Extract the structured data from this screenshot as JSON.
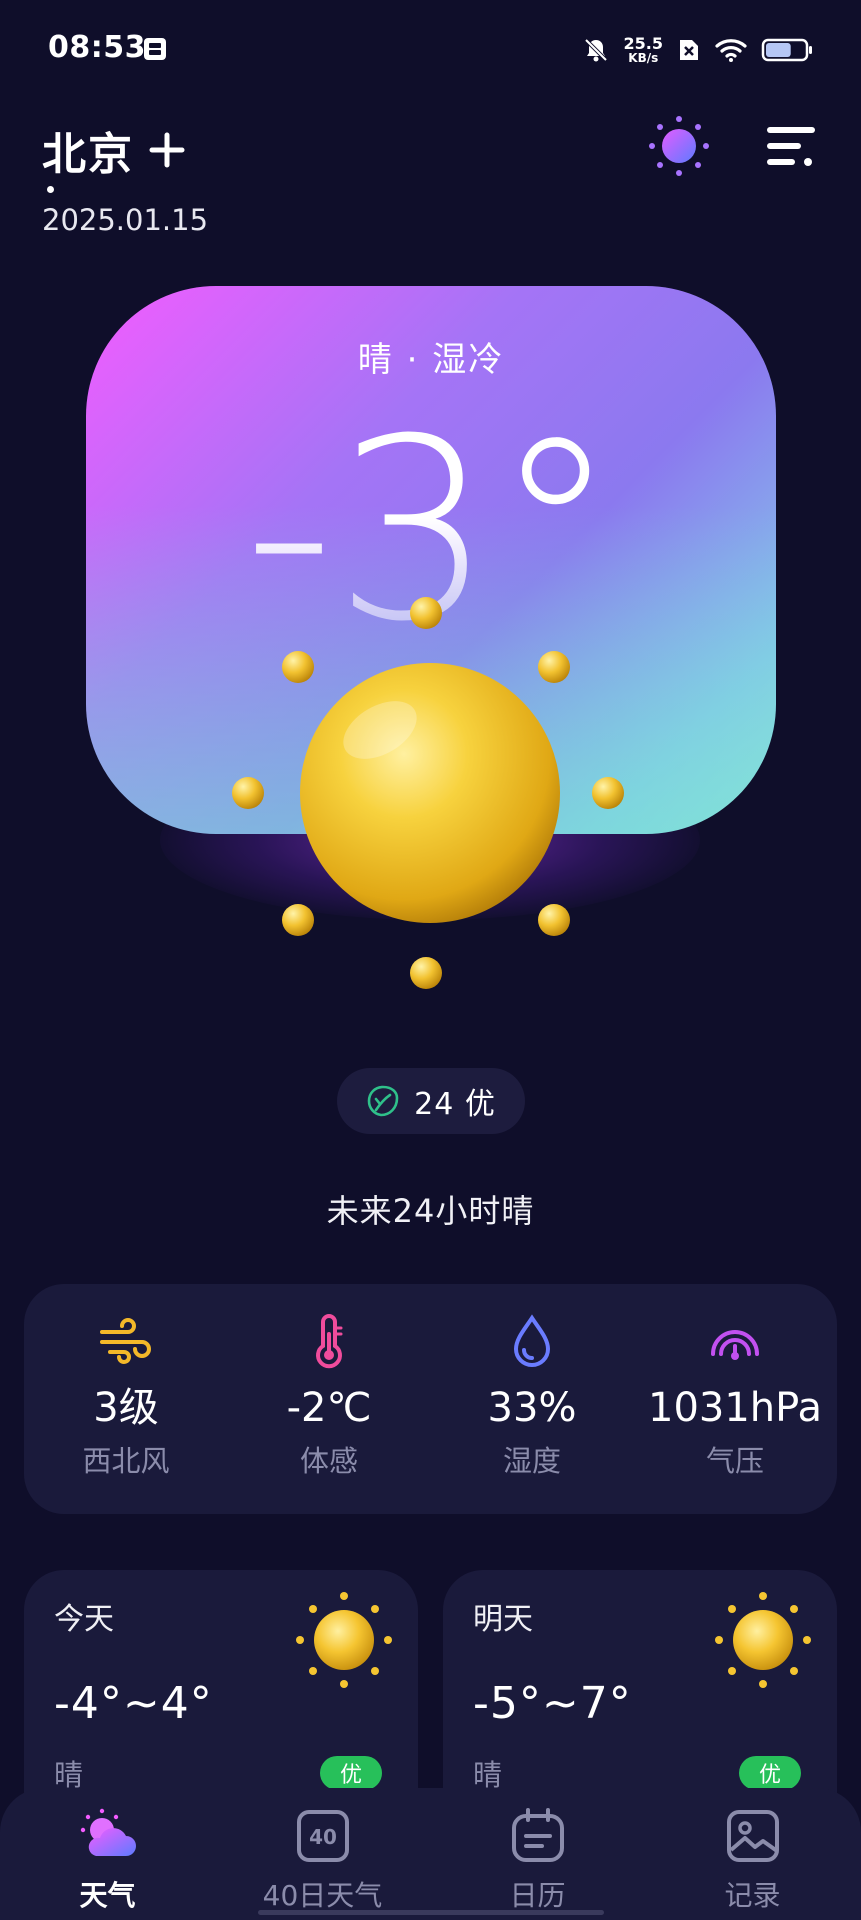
{
  "status_bar": {
    "time": "08:53",
    "net_speed_value": "25.5",
    "net_speed_unit": "KB/s",
    "battery_level": 0.65
  },
  "header": {
    "city": "北京",
    "date": "2025.01.15"
  },
  "hero": {
    "description": "晴 · 湿冷",
    "temperature": "-3°"
  },
  "aqi": {
    "value_text": "24 优"
  },
  "forecast_summary": "未来24小时晴",
  "stats": [
    {
      "value": "3级",
      "label": "西北风",
      "icon": "wind-icon"
    },
    {
      "value": "-2℃",
      "label": "体感",
      "icon": "thermometer-icon"
    },
    {
      "value": "33%",
      "label": "湿度",
      "icon": "humidity-drop-icon"
    },
    {
      "value": "1031hPa",
      "label": "气压",
      "icon": "pressure-gauge-icon"
    }
  ],
  "days": [
    {
      "label": "今天",
      "temp_range": "-4°~4°",
      "condition": "晴",
      "aqi_badge": "优"
    },
    {
      "label": "明天",
      "temp_range": "-5°~7°",
      "condition": "晴",
      "aqi_badge": "优"
    }
  ],
  "nav": {
    "items": [
      {
        "label": "天气",
        "active": true
      },
      {
        "label": "40日天气",
        "active": false
      },
      {
        "label": "日历",
        "active": false
      },
      {
        "label": "记录",
        "active": false
      }
    ],
    "forty_day_icon_text": "40"
  },
  "colors": {
    "background": "#0f0e2a",
    "panel": "#1a1a3b",
    "accent_pink": "#f35cff",
    "wind_yellow": "#f3b829",
    "thermo_pink": "#f04c9c",
    "humidity_blue": "#6a7cff",
    "pressure_purple": "#c250f0",
    "aqi_green": "#27c05a",
    "sun_yellow": "#f5c531"
  }
}
